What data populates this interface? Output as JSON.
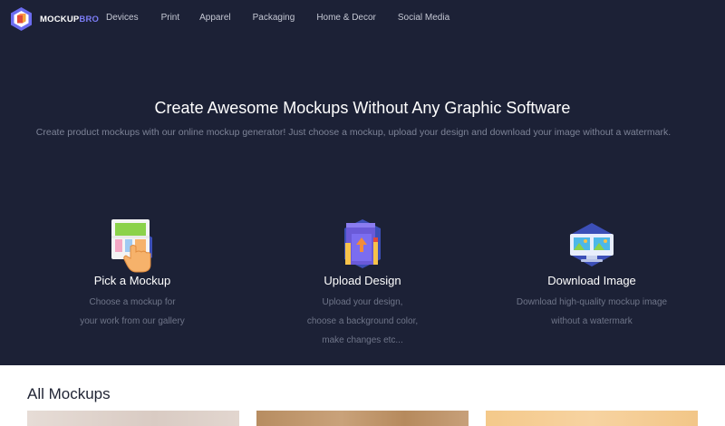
{
  "brand": {
    "name_part1": "MOCKUP",
    "name_part2": "BRO",
    "accent_color": "#7b7cf5"
  },
  "nav": {
    "items": [
      {
        "label": "Devices"
      },
      {
        "label": "Print"
      },
      {
        "label": "Apparel"
      },
      {
        "label": "Packaging"
      },
      {
        "label": "Home & Decor"
      },
      {
        "label": "Social Media"
      }
    ]
  },
  "hero": {
    "title": "Create Awesome Mockups Without Any Graphic Software",
    "subtitle": "Create product mockups with our online mockup generator! Just choose a mockup, upload your design and download your image without a watermark.",
    "background_color": "#1c2136"
  },
  "steps": [
    {
      "title": "Pick a Mockup",
      "desc_lines": [
        "Choose a mockup for",
        "your work from our gallery"
      ],
      "icon": "pick-mockup-icon"
    },
    {
      "title": "Upload Design",
      "desc_lines": [
        "Upload your design,",
        "choose a background color,",
        "make changes etc..."
      ],
      "icon": "upload-design-icon"
    },
    {
      "title": "Download Image",
      "desc_lines": [
        "Download high-quality mockup image",
        "without a watermark"
      ],
      "icon": "download-image-icon"
    }
  ],
  "mockups": {
    "title": "All Mockups"
  }
}
